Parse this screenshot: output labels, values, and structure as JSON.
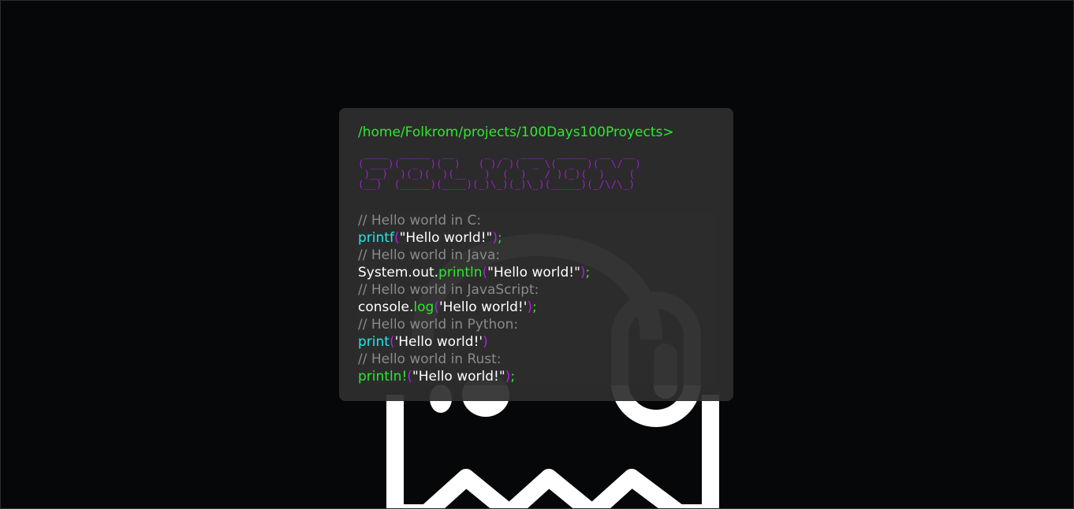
{
  "terminal": {
    "prompt": "/home/Folkrom/projects/100Days100Proyects>",
    "ascii_art": [
      " ____  _____  __     _  _  ____  _____  __  __ ",
      "( ___)(  _  )(  )   ( )/ )(  _ \\(  _  )(  \\/  )",
      " )__)  )(_)(  )(__   )  (  )   / )(_)(  )    ( ",
      "(__)  (_____)(____)(_)\\_)(_)\\_)(_____)(_/\\/\\_)"
    ],
    "code_lines": [
      {
        "comment": "// Hello world in C:"
      },
      {
        "code": {
          "prefix": "",
          "fn": "printf",
          "open": "(",
          "arg": "\"Hello world!\"",
          "close": ")",
          "semi": ";"
        }
      },
      {
        "comment": "// Hello world in Java:"
      },
      {
        "code": {
          "prefix": "System.out.",
          "fn": "println",
          "open": "(",
          "arg": "\"Hello world!\"",
          "close": ")",
          "semi": ";"
        }
      },
      {
        "comment": "// Hello world in JavaScript:"
      },
      {
        "code": {
          "prefix": "console.",
          "fn": "log",
          "open": "(",
          "arg": "'Hello world!'",
          "close": ")",
          "semi": ";"
        }
      },
      {
        "comment": "// Hello world in Python:"
      },
      {
        "code": {
          "prefix": "",
          "fn": "print",
          "open": "(",
          "arg": "'Hello world!'",
          "close": ")",
          "semi": ""
        }
      },
      {
        "comment": "// Hello world in Rust:"
      },
      {
        "code": {
          "prefix": "",
          "fn": "println!",
          "open": "(",
          "arg": "\"Hello world!\"",
          "close": ")",
          "semi": ";"
        }
      }
    ]
  },
  "colors": {
    "background": "#050708",
    "terminal_bg": "#2e2e2e",
    "prompt": "#2fe82f",
    "ascii": "#a020d0",
    "comment": "#8a8a8a",
    "function_cyan": "#27e5ea",
    "function_green": "#2fe82f",
    "paren": "#b21fe0",
    "string": "#ffffff"
  },
  "logo": {
    "icon": "ghost-headphones-icon"
  }
}
